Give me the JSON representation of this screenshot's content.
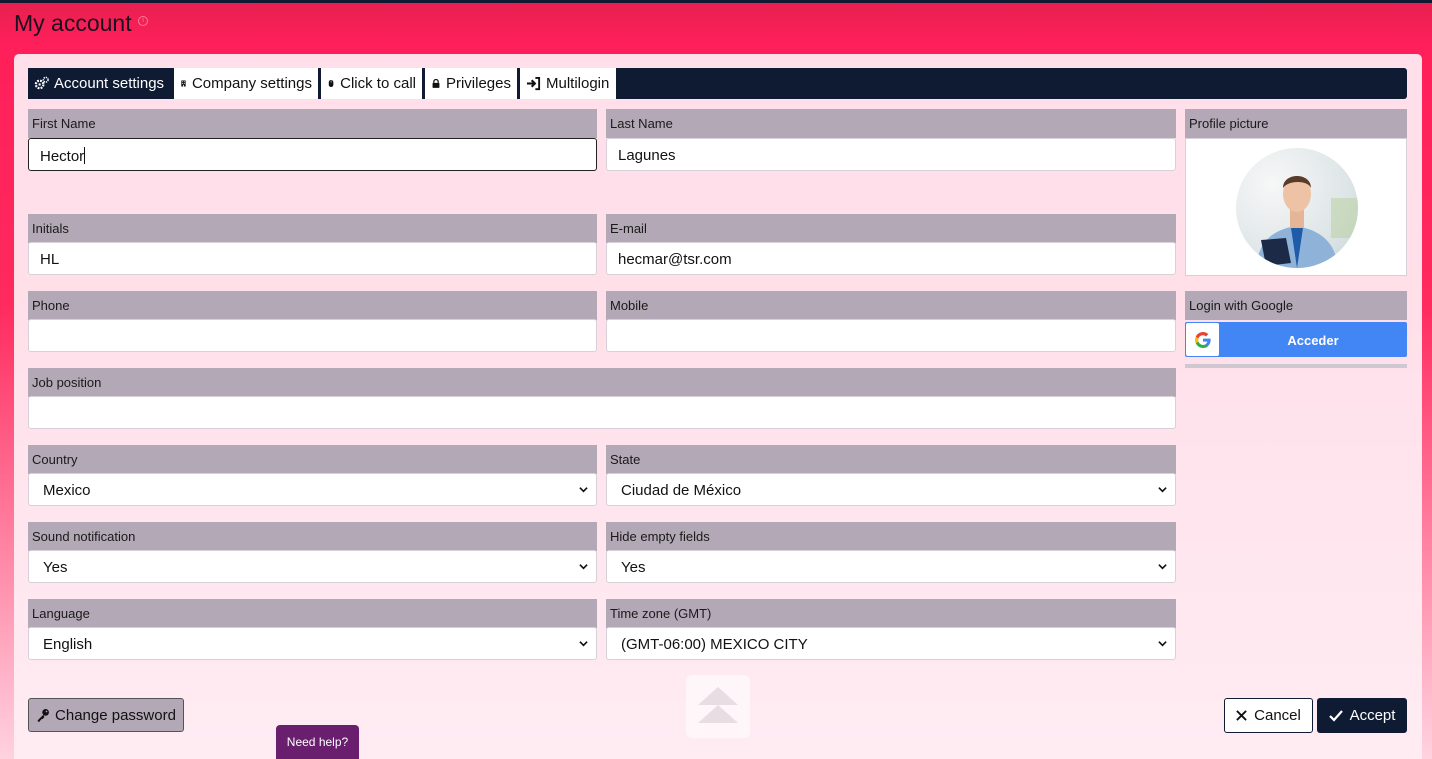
{
  "page": {
    "title": "My account"
  },
  "tabs": [
    {
      "label": "Account settings",
      "icon": "gears-icon"
    },
    {
      "label": "Company settings",
      "icon": "building-icon"
    },
    {
      "label": "Click to call",
      "icon": "mouse-icon"
    },
    {
      "label": "Privileges",
      "icon": "lock-icon"
    },
    {
      "label": "Multilogin",
      "icon": "sign-in-icon"
    }
  ],
  "form": {
    "first_name": {
      "label": "First Name",
      "value": "Hector"
    },
    "last_name": {
      "label": "Last Name",
      "value": "Lagunes"
    },
    "initials": {
      "label": "Initials",
      "value": "HL"
    },
    "email": {
      "label": "E-mail",
      "value": "hecmar@tsr.com"
    },
    "phone": {
      "label": "Phone",
      "value": ""
    },
    "mobile": {
      "label": "Mobile",
      "value": ""
    },
    "job_position": {
      "label": "Job position",
      "value": ""
    },
    "country": {
      "label": "Country",
      "value": "Mexico"
    },
    "state": {
      "label": "State",
      "value": "Ciudad de México"
    },
    "sound_notification": {
      "label": "Sound notification",
      "value": "Yes"
    },
    "hide_empty_fields": {
      "label": "Hide empty fields",
      "value": "Yes"
    },
    "language": {
      "label": "Language",
      "value": "English"
    },
    "time_zone": {
      "label": "Time zone (GMT)",
      "value": "(GMT-06:00) MEXICO CITY"
    }
  },
  "profile": {
    "label": "Profile picture"
  },
  "google": {
    "label": "Login with Google",
    "button_label": "Acceder"
  },
  "actions": {
    "change_password": "Change password",
    "cancel": "Cancel",
    "accept": "Accept",
    "help": "Need help?"
  },
  "colors": {
    "navy": "#0f1b32",
    "label_bg": "#b3a8b6",
    "google_blue": "#4285f4",
    "help_purple": "#6a1f6e"
  }
}
